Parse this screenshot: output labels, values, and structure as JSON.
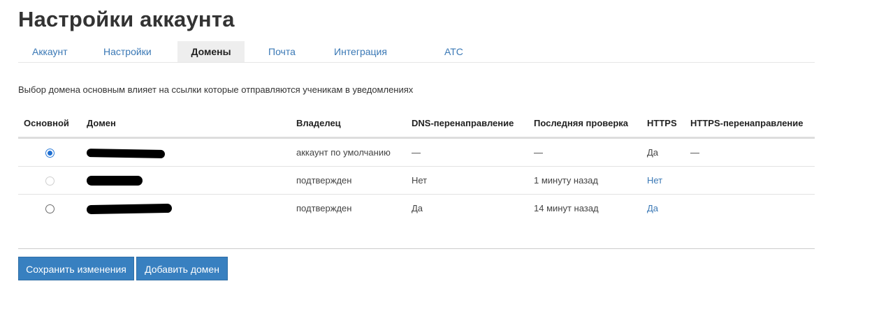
{
  "page": {
    "title": "Настройки аккаунта",
    "description": "Выбор домена основным влияет на ссылки которые отправляются ученикам в уведомлениях"
  },
  "tabs": [
    {
      "label": "Аккаунт",
      "active": false
    },
    {
      "label": "Настройки",
      "active": false
    },
    {
      "label": "Домены",
      "active": true
    },
    {
      "label": "Почта",
      "active": false
    },
    {
      "label": "Интеграция",
      "active": false
    },
    {
      "label": "АТС",
      "active": false
    }
  ],
  "table": {
    "headers": {
      "primary": "Основной",
      "domain": "Домен",
      "owner": "Владелец",
      "dns": "DNS-перенаправление",
      "last_check": "Последняя проверка",
      "https": "HTTPS",
      "https_redirect": "HTTPS-перенаправление"
    },
    "rows": [
      {
        "primary": "checked",
        "owner": "аккаунт по умолчанию",
        "dns": "—",
        "last_check": "—",
        "https": "Да",
        "https_redirect": "—"
      },
      {
        "primary": "disabled",
        "owner": "подтвержден",
        "dns": "Нет",
        "last_check": "1 минуту назад",
        "https": "Нет",
        "https_redirect": ""
      },
      {
        "primary": "unchecked",
        "owner": "подтвержден",
        "dns": "Да",
        "last_check": "14 минут назад",
        "https": "Да",
        "https_redirect": ""
      }
    ]
  },
  "actions": {
    "save_label": "Сохранить изменения",
    "add_domain_label": "Добавить домен"
  },
  "colors": {
    "link": "#3a78b5",
    "button": "#3880c0",
    "active_tab_bg": "#eeeeee"
  }
}
